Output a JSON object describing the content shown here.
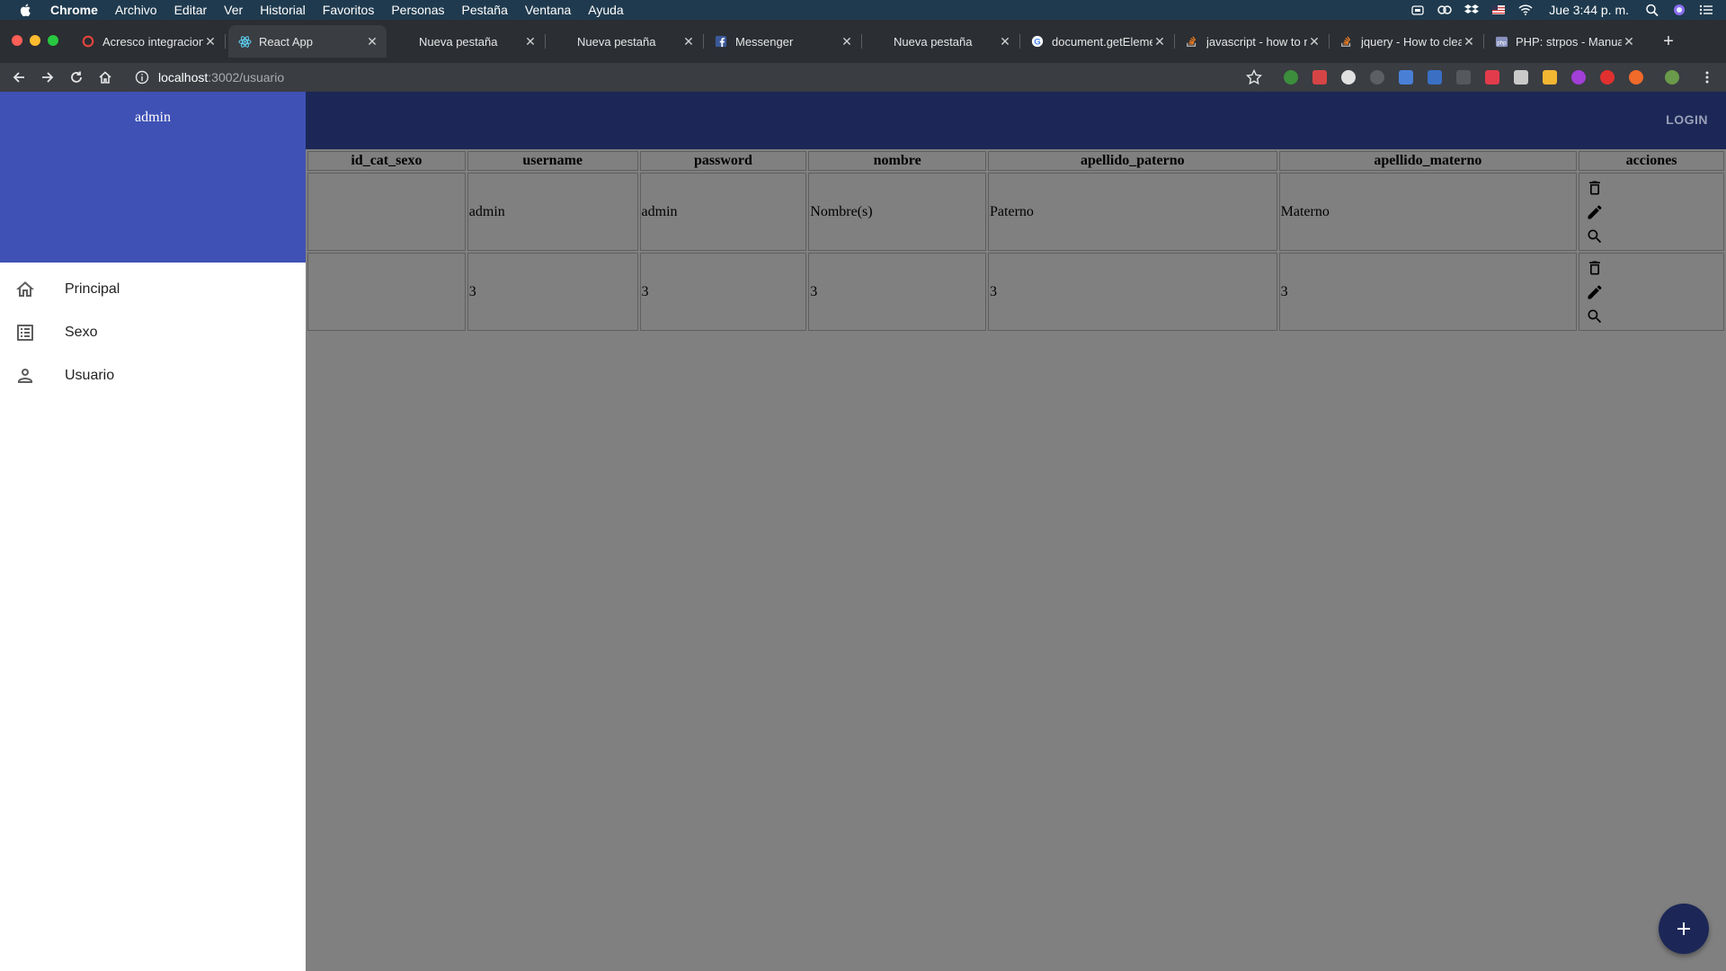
{
  "menubar": {
    "items": [
      "Chrome",
      "Archivo",
      "Editar",
      "Ver",
      "Historial",
      "Favoritos",
      "Personas",
      "Pestaña",
      "Ventana",
      "Ayuda"
    ],
    "clock": "Jue 3:44 p. m."
  },
  "tabs": [
    {
      "title": "Acresco integraciones",
      "favicon": "opera-icon"
    },
    {
      "title": "React App",
      "favicon": "react-icon",
      "active": true
    },
    {
      "title": "Nueva pestaña",
      "favicon": ""
    },
    {
      "title": "Nueva pestaña",
      "favicon": ""
    },
    {
      "title": "Messenger",
      "favicon": "facebook-icon"
    },
    {
      "title": "Nueva pestaña",
      "favicon": ""
    },
    {
      "title": "document.getElementBy",
      "favicon": "google-icon"
    },
    {
      "title": "javascript - how to re",
      "favicon": "stackoverflow-icon"
    },
    {
      "title": "jquery - How to clear",
      "favicon": "stackoverflow-icon"
    },
    {
      "title": "PHP: strpos - Manual",
      "favicon": "php-icon"
    }
  ],
  "address": {
    "host": "localhost",
    "path": ":3002/usuario"
  },
  "appbar": {
    "login_label": "LOGIN"
  },
  "drawer": {
    "user": "admin",
    "items": [
      {
        "label": "Principal",
        "icon": "home-icon"
      },
      {
        "label": "Sexo",
        "icon": "list-icon"
      },
      {
        "label": "Usuario",
        "icon": "person-icon"
      }
    ]
  },
  "table": {
    "columns": [
      "id_cat_sexo",
      "username",
      "password",
      "nombre",
      "apellido_paterno",
      "apellido_materno",
      "acciones"
    ],
    "rows": [
      [
        "",
        "admin",
        "admin",
        "Nombre(s)",
        "Paterno",
        "Materno"
      ],
      [
        "",
        "3",
        "3",
        "3",
        "3",
        "3"
      ]
    ]
  },
  "colors": {
    "drawer_header": "#3f51b5",
    "appbar": "#1c2757",
    "backdrop": "#808080"
  }
}
